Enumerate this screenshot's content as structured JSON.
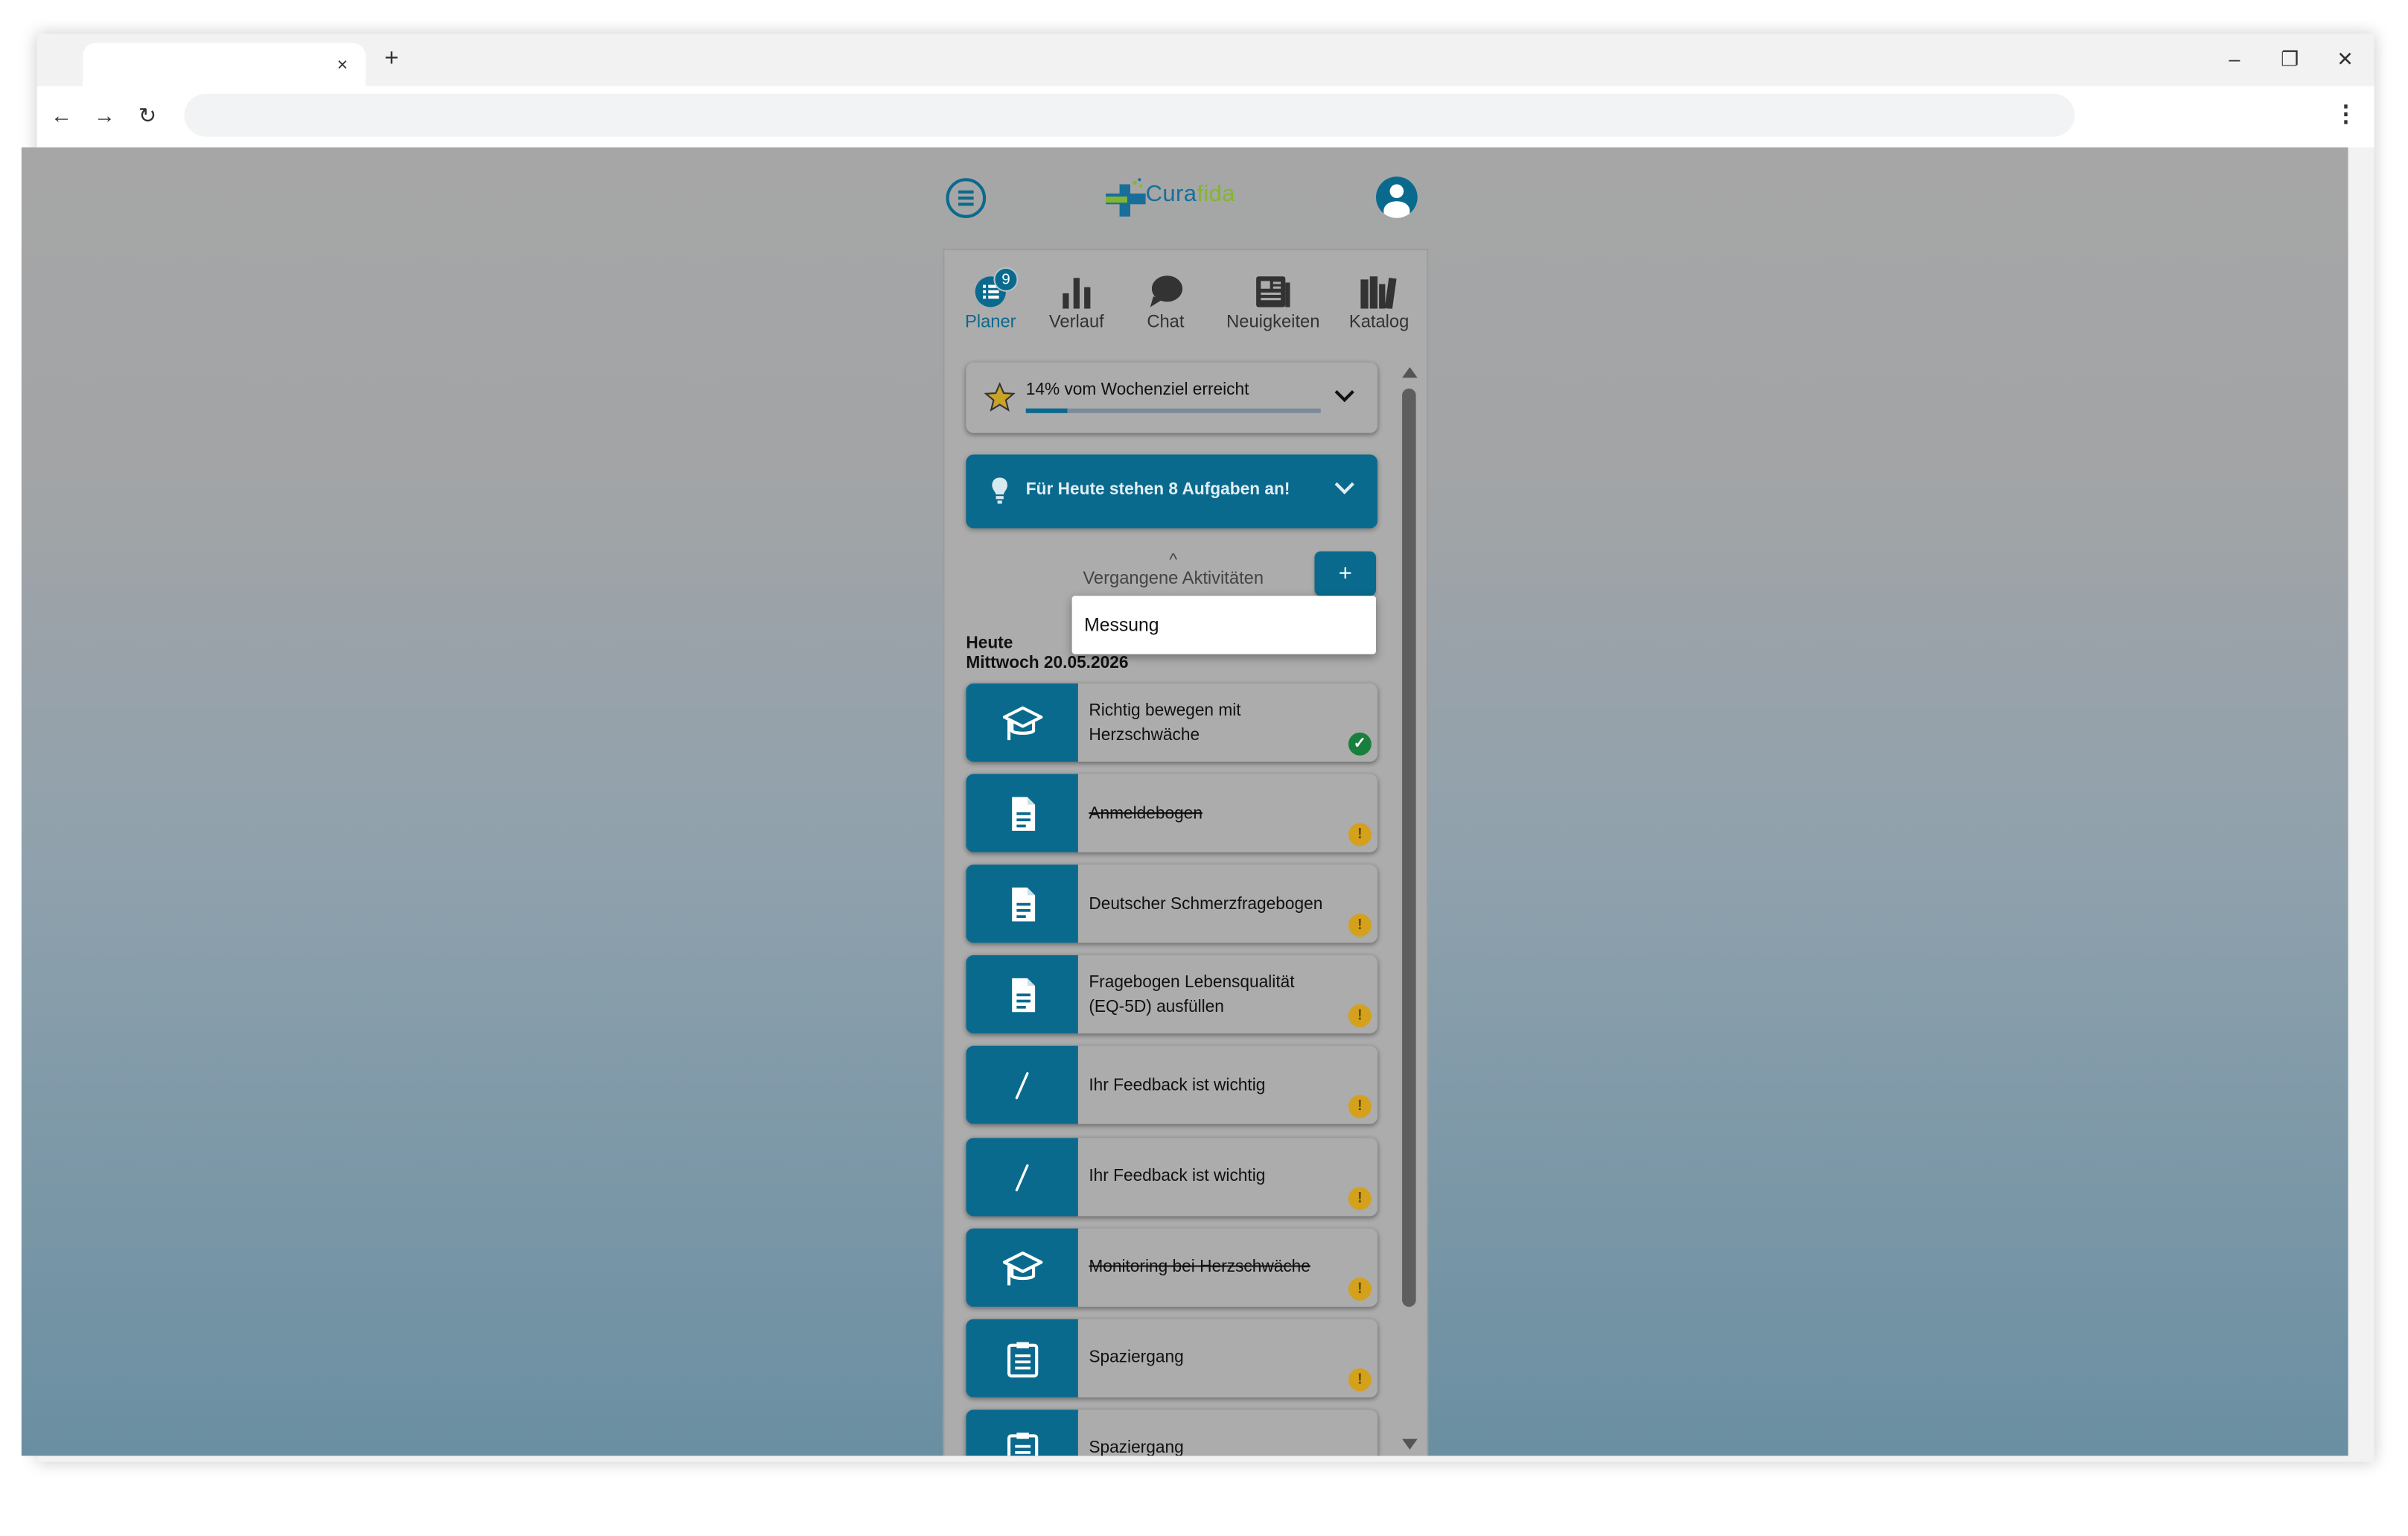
{
  "browser": {
    "tab_close": "×",
    "new_tab": "+",
    "minimize": "–",
    "restore": "❐",
    "close": "✕",
    "back": "←",
    "forward": "→",
    "reload": "↻",
    "menu": "⋮"
  },
  "app": {
    "logo": {
      "part1": "Cura",
      "part2": "fida"
    },
    "nav": [
      {
        "label": "Planer",
        "icon": "list-icon",
        "badge": "9",
        "active": true
      },
      {
        "label": "Verlauf",
        "icon": "bar-chart-icon"
      },
      {
        "label": "Chat",
        "icon": "chat-icon"
      },
      {
        "label": "Neuigkeiten",
        "icon": "newspaper-icon"
      },
      {
        "label": "Katalog",
        "icon": "books-icon"
      }
    ],
    "goal": {
      "text": "14% vom Wochenziel erreicht",
      "progress_percent": 14
    },
    "tasks_banner": "Für Heute stehen 8 Aufgaben an!",
    "past_activities": {
      "caret": "^",
      "label": "Vergangene Aktivitäten"
    },
    "add_button": "+",
    "dropdown": {
      "items": [
        "Messung"
      ]
    },
    "day": {
      "label": "Heute",
      "date": "Mittwoch 20.05.2026"
    },
    "tasks": [
      {
        "label": "Richtig bewegen mit Herzschwäche",
        "icon": "graduation-cap-icon",
        "status": "done",
        "strikethrough": false,
        "status_glyph": "✓"
      },
      {
        "label": "Anmeldebogen",
        "icon": "document-icon",
        "status": "warning",
        "strikethrough": true,
        "status_glyph": "!"
      },
      {
        "label": "Deutscher Schmerzfragebogen",
        "icon": "document-icon",
        "status": "warning",
        "strikethrough": false,
        "status_glyph": "!"
      },
      {
        "label": "Fragebogen Lebensqualität (EQ-5D) ausfüllen",
        "icon": "document-icon",
        "status": "warning",
        "strikethrough": false,
        "status_glyph": "!"
      },
      {
        "label": "Ihr Feedback ist wichtig",
        "icon": "pen-icon",
        "status": "warning",
        "strikethrough": false,
        "status_glyph": "!"
      },
      {
        "label": "Ihr Feedback ist wichtig",
        "icon": "pen-icon",
        "status": "warning",
        "strikethrough": false,
        "status_glyph": "!"
      },
      {
        "label": "Monitoring bei Herzschwäche",
        "icon": "graduation-cap-icon",
        "status": "warning",
        "strikethrough": true,
        "status_glyph": "!"
      },
      {
        "label": "Spaziergang",
        "icon": "clipboard-icon",
        "status": "warning",
        "strikethrough": false,
        "status_glyph": "!"
      },
      {
        "label": "Spaziergang",
        "icon": "clipboard-icon",
        "status": "warning",
        "strikethrough": false,
        "status_glyph": "!"
      }
    ],
    "colors": {
      "primary": "#0a6a8e",
      "logo_blue": "#176f99",
      "logo_green": "#85b52f",
      "ok": "#18803c",
      "warn": "#d4a11c"
    }
  }
}
